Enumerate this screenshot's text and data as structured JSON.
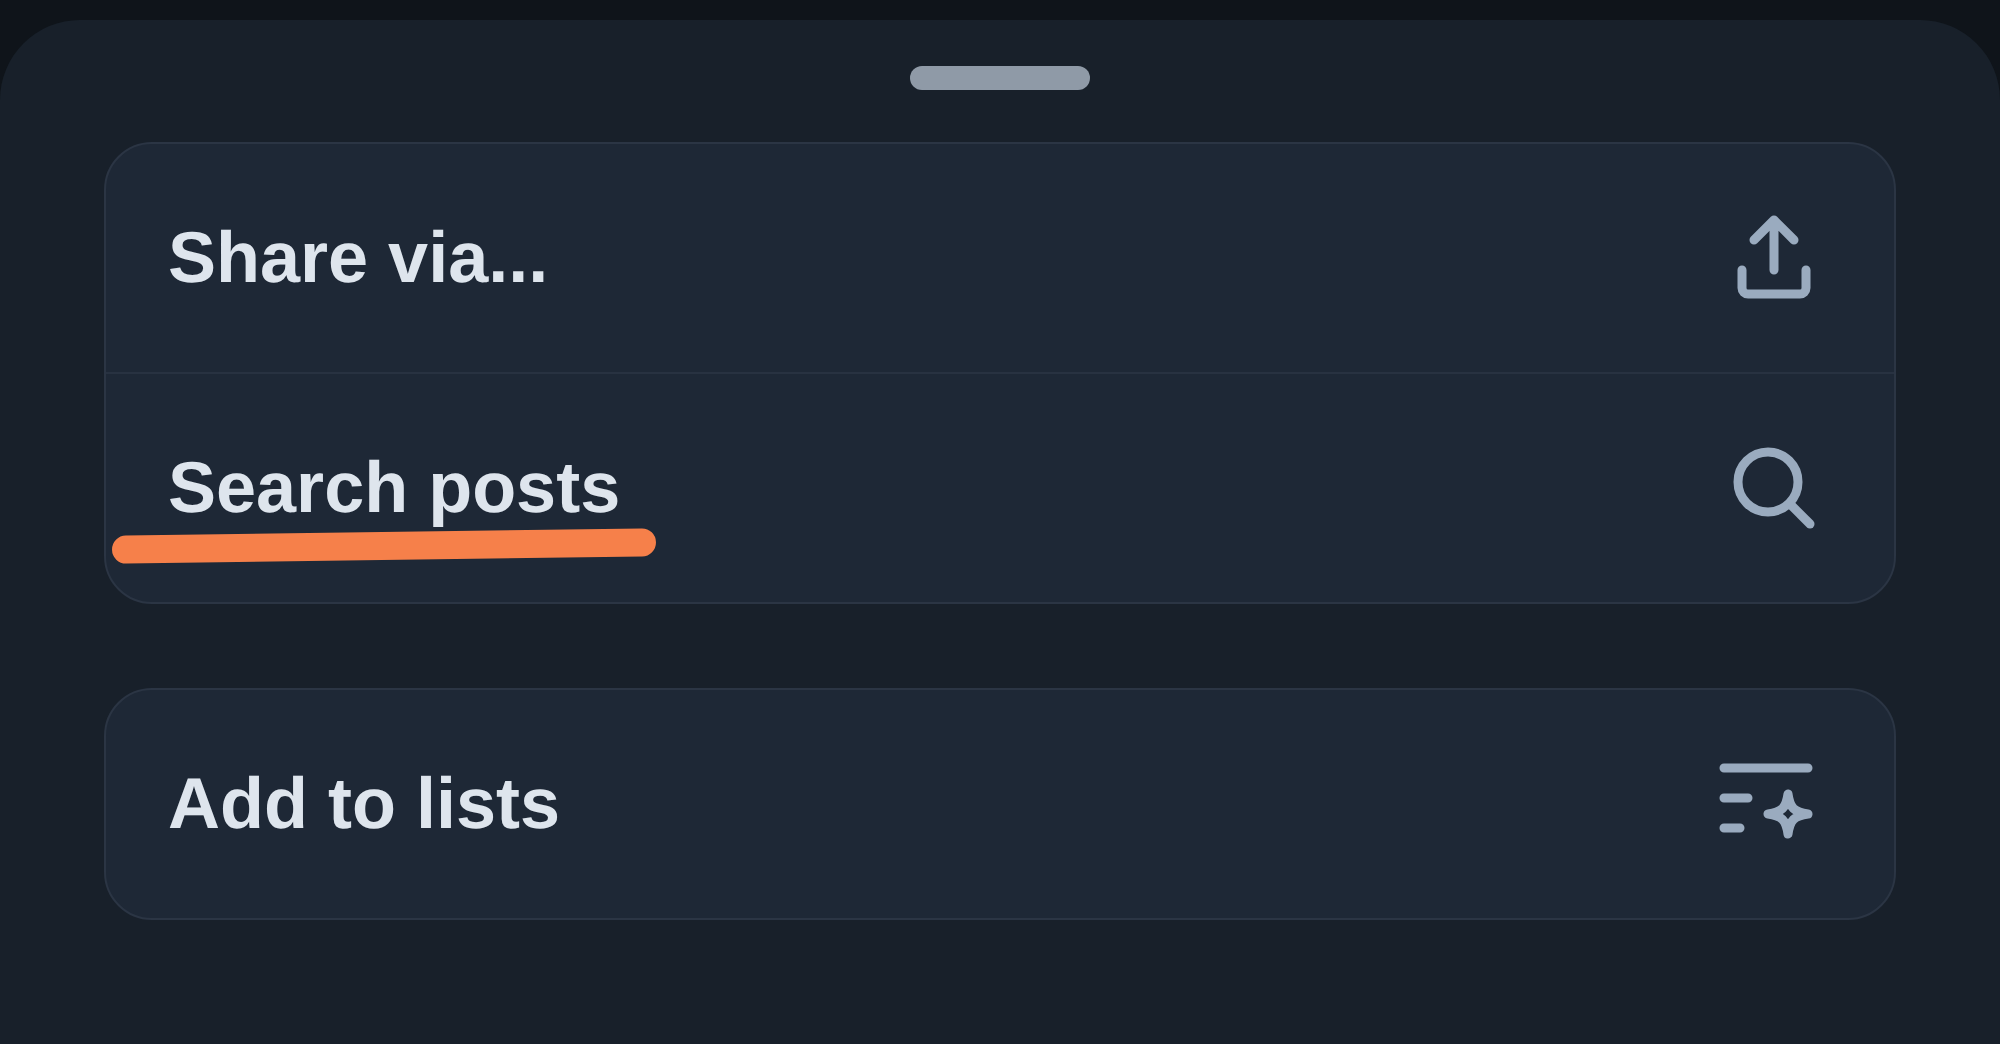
{
  "sheet": {
    "groups": [
      {
        "items": [
          {
            "label": "Share via...",
            "kind": "share",
            "highlighted": false
          },
          {
            "label": "Search posts",
            "kind": "search",
            "highlighted": true
          }
        ]
      },
      {
        "items": [
          {
            "label": "Add to lists",
            "kind": "lists",
            "highlighted": false
          }
        ]
      }
    ]
  }
}
